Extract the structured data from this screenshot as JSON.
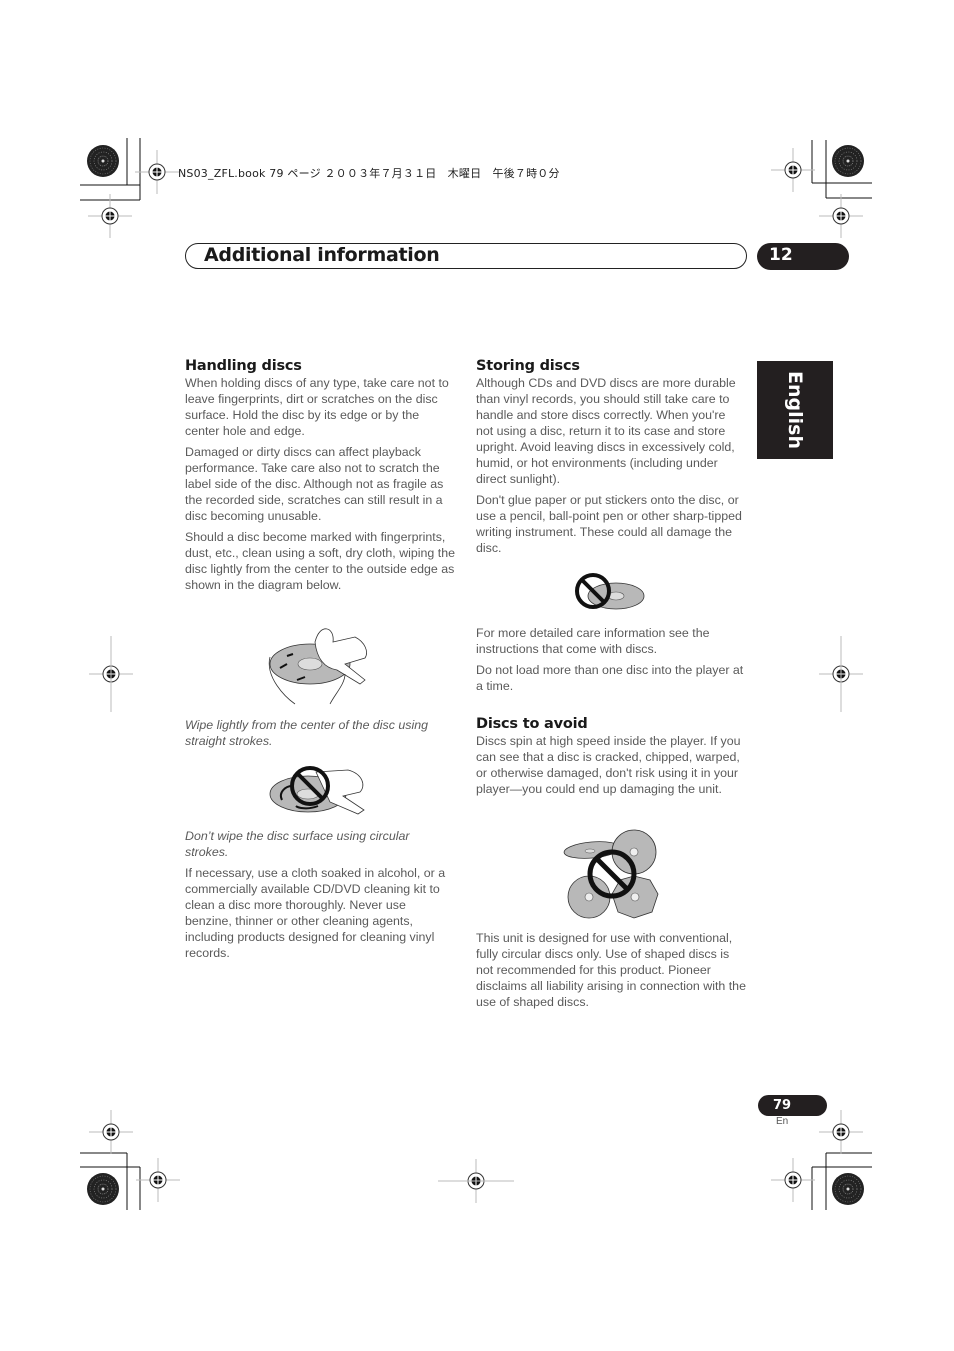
{
  "print_header": {
    "book_line": "NS03_ZFL.book  79 ページ  ２００３年７月３１日　木曜日　午後７時０分"
  },
  "header": {
    "title": "Additional information",
    "chapter_number": "12"
  },
  "language_tab": {
    "label": "English"
  },
  "left_column": {
    "handling": {
      "heading": "Handling discs",
      "paragraphs": [
        "When holding discs of any type, take care not to leave fingerprints, dirt or scratches on the disc surface. Hold the disc by its edge or by the center hole and edge.",
        "Damaged or dirty discs can affect playback performance. Take care also not to scratch the label side of the disc. Although not as fragile as the recorded side, scratches can still result in a disc becoming unusable.",
        "Should a disc become marked with fingerprints, dust, etc., clean using a soft, dry cloth, wiping the disc lightly from the center to the outside edge as shown in the diagram below."
      ],
      "caption_straight": "Wipe lightly from the center of the disc using straight strokes.",
      "caption_circular": "Don’t wipe the disc surface using circular strokes.",
      "final_paragraph": "If necessary, use a cloth soaked in alcohol, or a commercially available CD/DVD cleaning kit to clean a disc more thoroughly. Never use benzine, thinner or other cleaning agents, including products designed for cleaning vinyl records."
    }
  },
  "right_column": {
    "storing": {
      "heading": "Storing discs",
      "paragraphs": [
        "Although CDs and DVD discs are more durable than vinyl records, you should still take care to handle and store discs correctly. When you're not using a disc, return it to its case and store upright. Avoid leaving discs in excessively cold, humid, or hot environments (including under direct sunlight).",
        "Don't glue paper or put stickers onto the disc, or use a pencil, ball-point pen or other sharp-tipped writing instrument. These could all damage the disc."
      ],
      "after_illustration": [
        "For more detailed care information see the instructions that come with discs.",
        "Do not load more than one disc into the player at a time."
      ]
    },
    "avoid": {
      "heading": "Discs to avoid",
      "paragraph": "Discs spin at high speed inside the player. If you can see that a disc is cracked, chipped, warped, or otherwise damaged, don't risk using it in your player—you could end up damaging the unit.",
      "after_illustration": "This unit is designed for use with conventional, fully circular discs only. Use of shaped discs is not recommended for this product. Pioneer disclaims all liability arising in connection with the use of shaped discs."
    }
  },
  "footer": {
    "page_number": "79",
    "language_code": "En"
  },
  "icons": {
    "registration_mark": "crosshair-circle",
    "color_target": "radial-starburst",
    "prohibited": "no-symbol"
  },
  "colors": {
    "dark": "#231f20",
    "text": "#5a5a5a",
    "disc_gray": "#b5b5b5"
  }
}
